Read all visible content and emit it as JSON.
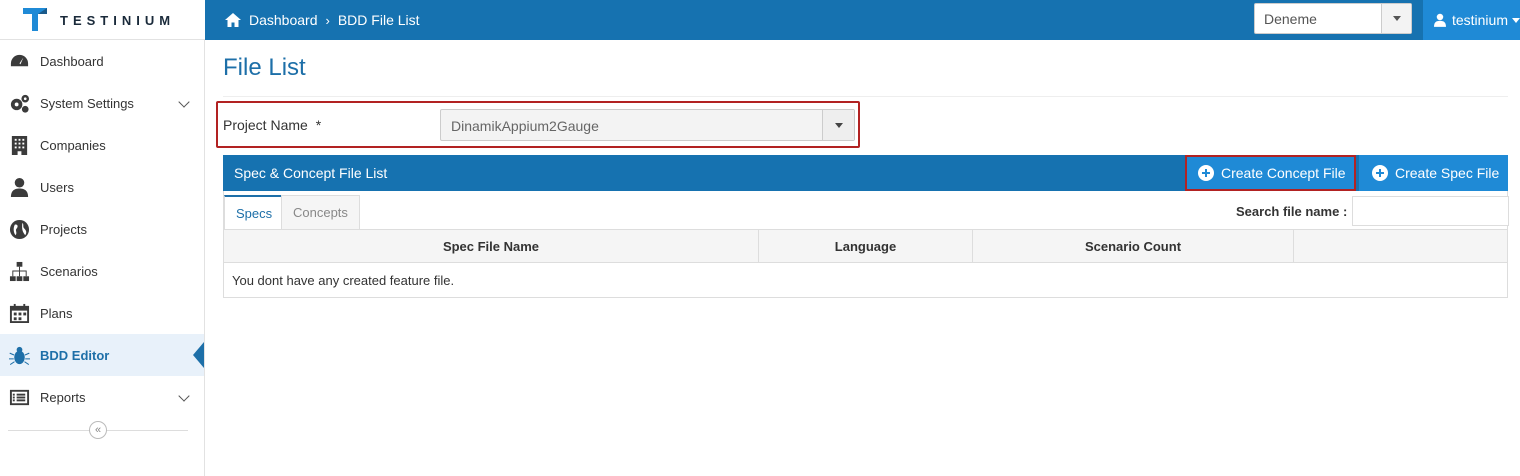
{
  "app": {
    "logo_text": "TESTINIUM"
  },
  "breadcrumb": {
    "home": "Dashboard",
    "current": "BDD File List"
  },
  "workspace_select": {
    "value": "Deneme"
  },
  "user": {
    "name": "testinium"
  },
  "sidebar": {
    "items": [
      {
        "label": "Dashboard",
        "icon": "dashboard-icon"
      },
      {
        "label": "System Settings",
        "icon": "gears-icon",
        "expandable": true
      },
      {
        "label": "Companies",
        "icon": "building-icon"
      },
      {
        "label": "Users",
        "icon": "user-icon"
      },
      {
        "label": "Projects",
        "icon": "globe-icon"
      },
      {
        "label": "Scenarios",
        "icon": "sitemap-icon"
      },
      {
        "label": "Plans",
        "icon": "calendar-icon"
      },
      {
        "label": "BDD Editor",
        "icon": "bug-icon",
        "active": true
      },
      {
        "label": "Reports",
        "icon": "list-icon",
        "expandable": true
      }
    ],
    "collapse_glyph": "«"
  },
  "page": {
    "title": "File List"
  },
  "project": {
    "label": "Project Name",
    "required_mark": "*",
    "value": "DinamikAppium2Gauge"
  },
  "panel": {
    "title": "Spec & Concept File List",
    "create_concept": "Create Concept File",
    "create_spec": "Create Spec File"
  },
  "tabs": [
    {
      "label": "Specs",
      "active": true
    },
    {
      "label": "Concepts",
      "active": false
    }
  ],
  "search": {
    "label": "Search file name :",
    "value": ""
  },
  "table": {
    "columns": [
      "Spec File Name",
      "Language",
      "Scenario Count",
      ""
    ],
    "empty_message": "You dont have any created feature file."
  },
  "colors": {
    "primary": "#1672b0",
    "accent": "#1f8ad6",
    "highlight": "#b22222"
  }
}
